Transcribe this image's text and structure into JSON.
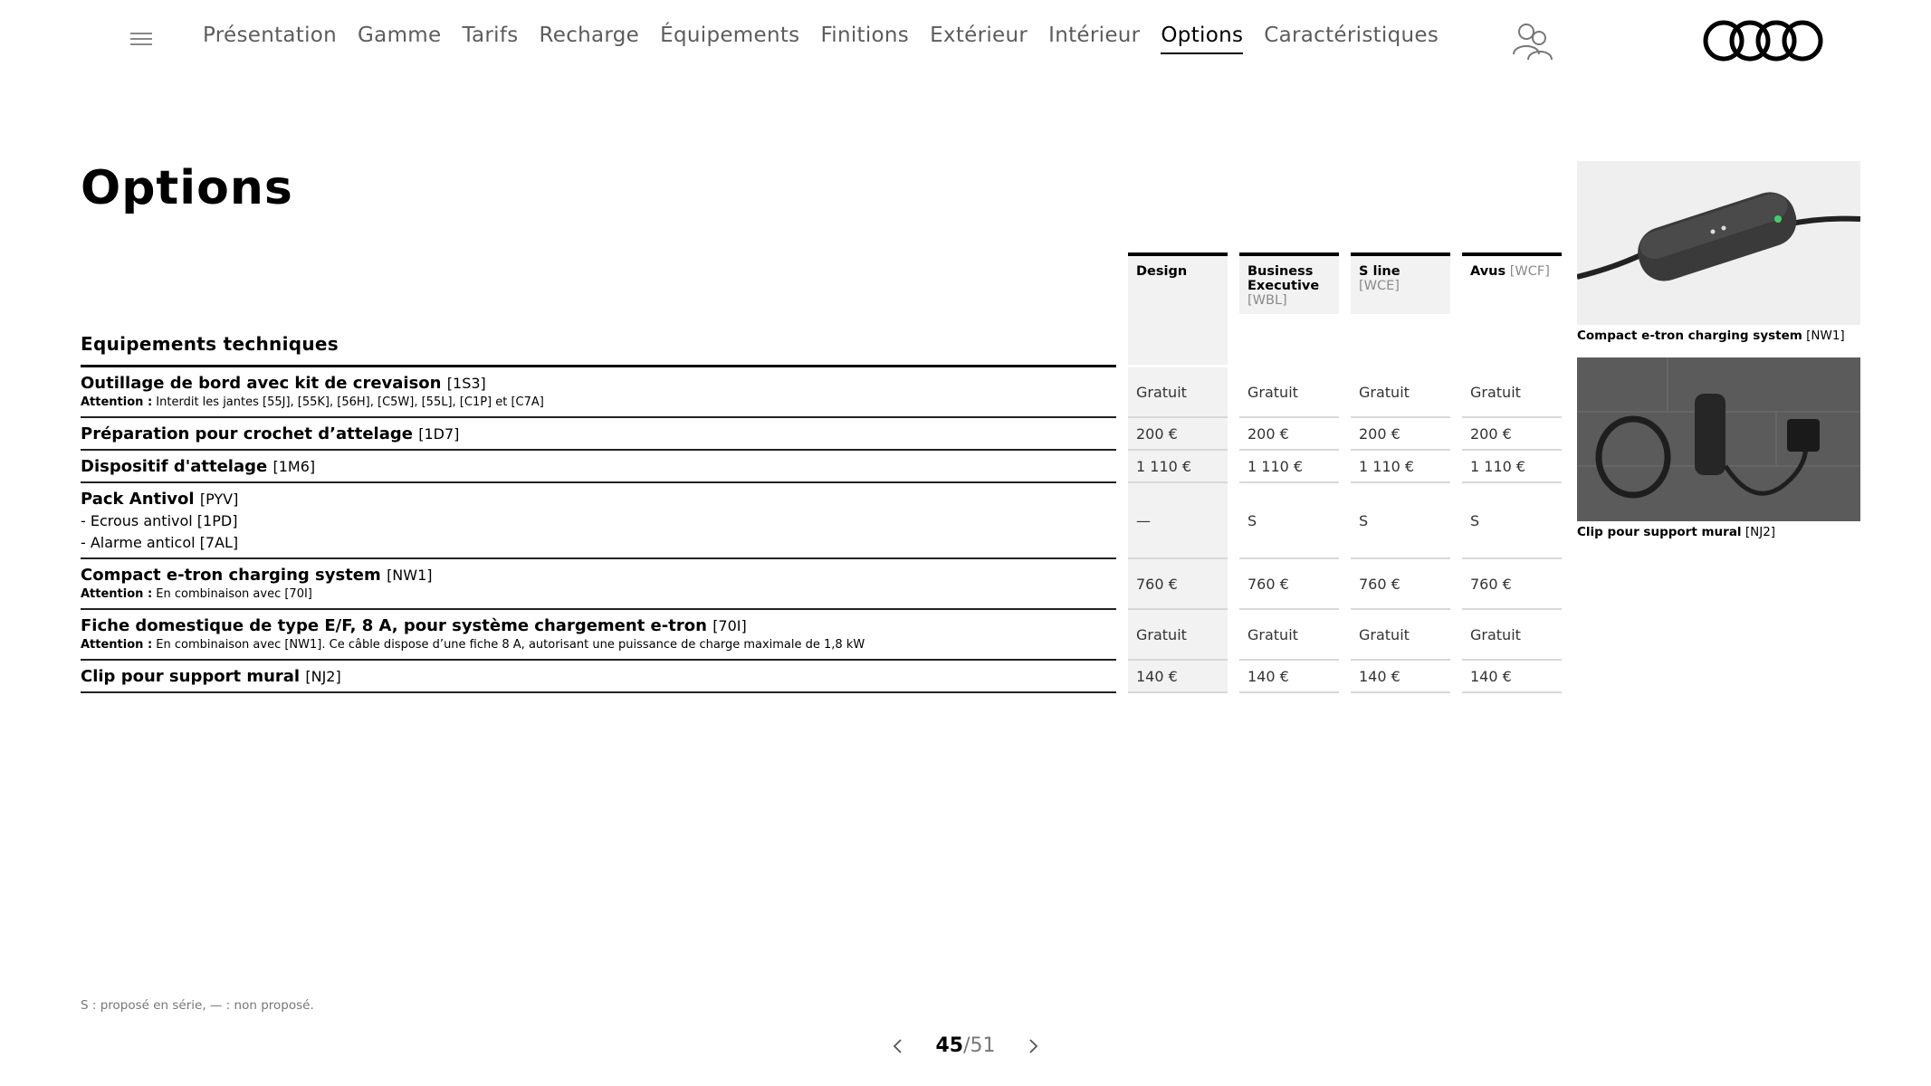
{
  "nav": {
    "items": [
      "Présentation",
      "Gamme",
      "Tarifs",
      "Recharge",
      "Équipements",
      "Finitions",
      "Extérieur",
      "Intérieur",
      "Options",
      "Caractéristiques"
    ],
    "active_index": 8,
    "icons": {
      "menu": "hamburger-icon",
      "contact": "dealer-contact-icon",
      "logo": "audi-rings-logo"
    }
  },
  "page": {
    "title": "Options"
  },
  "columns": [
    {
      "name": "Design",
      "code": ""
    },
    {
      "name": "Business Executive",
      "code": "[WBL]"
    },
    {
      "name": "S line",
      "code": "[WCE]"
    },
    {
      "name": "Avus",
      "code": "[WCF]"
    }
  ],
  "section": {
    "title": "Equipements techniques"
  },
  "rows": [
    {
      "title": "Outillage de bord avec kit de crevaison",
      "code": "[1S3]",
      "note_label": "Attention :",
      "note": "Interdit les jantes [55J], [55K], [56H], [C5W], [55L], [C1P] et [C7A]",
      "subs": [],
      "values": [
        "Gratuit",
        "Gratuit",
        "Gratuit",
        "Gratuit"
      ]
    },
    {
      "title": "Préparation pour crochet d’attelage",
      "code": "[1D7]",
      "note_label": "",
      "note": "",
      "subs": [],
      "values": [
        "200 €",
        "200 €",
        "200 €",
        "200 €"
      ]
    },
    {
      "title": "Dispositif d'attelage",
      "code": "[1M6]",
      "note_label": "",
      "note": "",
      "subs": [],
      "values": [
        "1 110 €",
        "1 110 €",
        "1 110 €",
        "1 110 €"
      ]
    },
    {
      "title": "Pack Antivol",
      "code": "[PYV]",
      "note_label": "",
      "note": "",
      "subs": [
        "- Ecrous antivol [1PD]",
        "- Alarme anticol [7AL]"
      ],
      "values": [
        "—",
        "S",
        "S",
        "S"
      ]
    },
    {
      "title": "Compact e-tron charging system",
      "code": "[NW1]",
      "note_label": "Attention :",
      "note": "En combinaison avec [70I]",
      "subs": [],
      "values": [
        "760 €",
        "760 €",
        "760 €",
        "760 €"
      ]
    },
    {
      "title": "Fiche domestique de type E/F, 8 A, pour système chargement e-tron",
      "code": "[70I]",
      "note_label": "Attention :",
      "note": "En combinaison avec [NW1]. Ce câble dispose d’une fiche 8 A, autorisant une puissance de charge maximale de 1,8 kW",
      "subs": [],
      "values": [
        "Gratuit",
        "Gratuit",
        "Gratuit",
        "Gratuit"
      ]
    },
    {
      "title": "Clip pour support mural",
      "code": "[NJ2]",
      "note_label": "",
      "note": "",
      "subs": [],
      "values": [
        "140 €",
        "140 €",
        "140 €",
        "140 €"
      ]
    }
  ],
  "images": [
    {
      "caption": "Compact e-tron charging system",
      "code": "[NW1]"
    },
    {
      "caption": "Clip pour support mural",
      "code": "[NJ2]"
    }
  ],
  "footnote": "S : proposé en série, — : non proposé.",
  "pagination": {
    "current": "45",
    "total": "/51"
  }
}
